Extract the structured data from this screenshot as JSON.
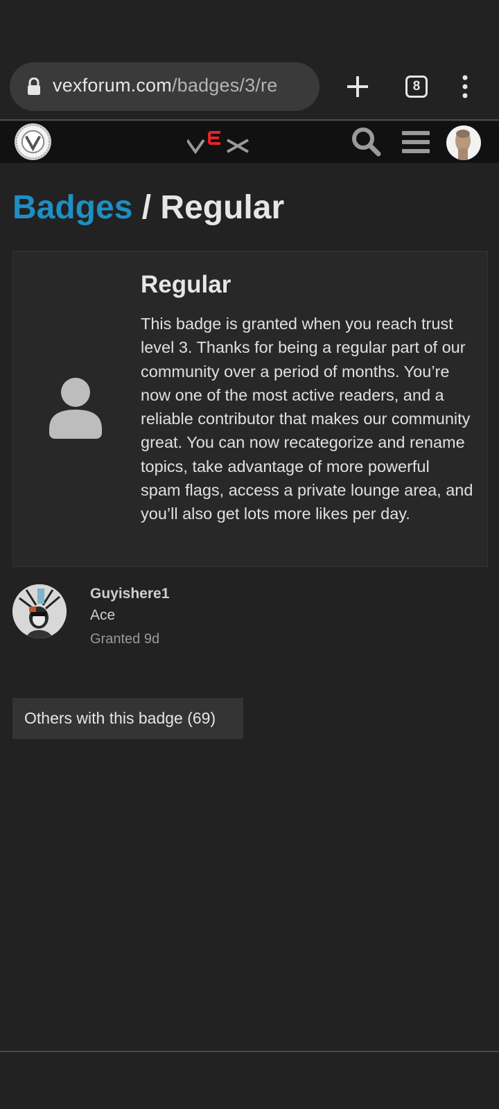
{
  "browser": {
    "url_host": "vexforum.com",
    "url_path": "/badges/3/re",
    "tab_count": "8"
  },
  "breadcrumb": {
    "parent": "Badges",
    "separator": " / ",
    "current": "Regular"
  },
  "badge": {
    "title": "Regular",
    "description": "This badge is granted when you reach trust level 3. Thanks for being a regular part of our community over a period of months. You’re now one of the most active readers, and a reliable contributor that makes our community great. You can now recategorize and rename topics, take advantage of more powerful spam flags, access a private lounge area, and you’ll also get lots more likes per day."
  },
  "grant": {
    "username": "Guyishere1",
    "user_title": "Ace",
    "granted_text": "Granted 9d"
  },
  "others_button": "Others with this badge (69)",
  "colors": {
    "background": "#222222",
    "link": "#1e8fc2",
    "vex_red": "#e0242c"
  }
}
